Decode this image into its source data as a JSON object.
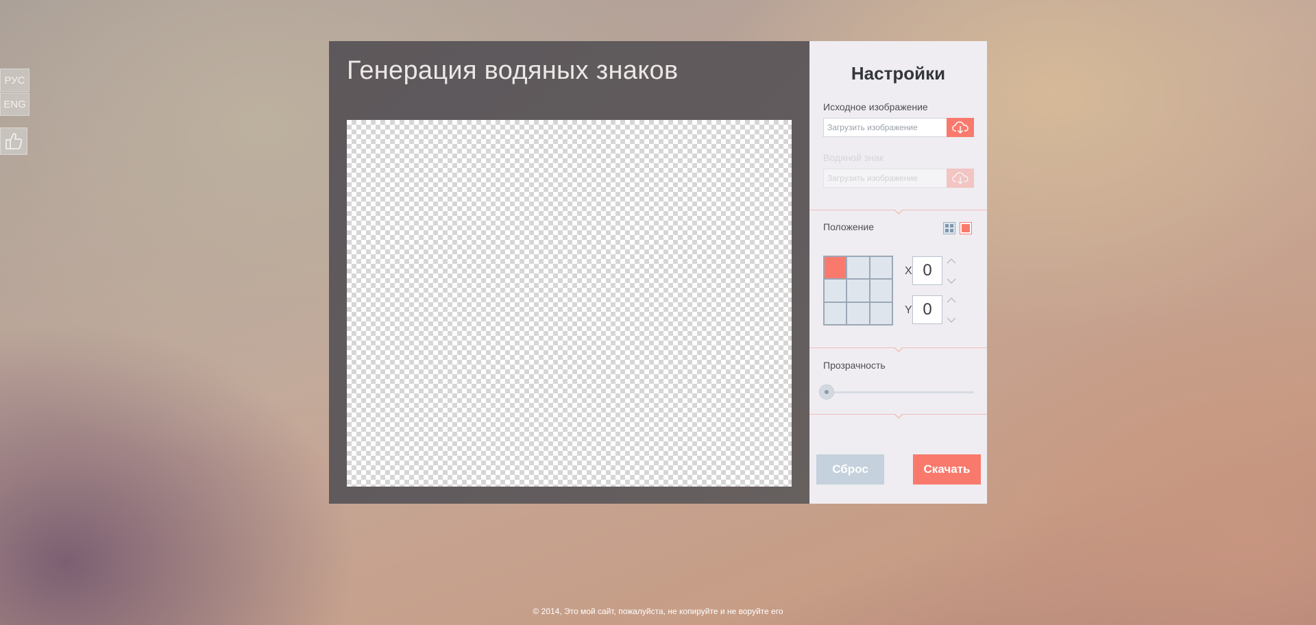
{
  "languages": [
    "РУС",
    "ENG"
  ],
  "app": {
    "title": "Генерация водяных знаков"
  },
  "settings": {
    "title": "Настройки",
    "source": {
      "label": "Исходное изображение",
      "placeholder": "Загрузить изображение"
    },
    "watermark": {
      "label": "Водяной знак",
      "placeholder": "Загрузить изображение",
      "disabled": true
    },
    "position": {
      "label": "Положение",
      "mode_icons": [
        "grid-mode-icon",
        "single-mode-icon"
      ],
      "selected_cell": "top-left",
      "x_label": "X",
      "x_value": "0",
      "y_label": "Y",
      "y_value": "0"
    },
    "opacity": {
      "label": "Прозрачность",
      "value": 0
    },
    "buttons": {
      "reset": "Сброс",
      "download": "Скачать"
    }
  },
  "colors": {
    "accent": "#f97a6d",
    "reset_button": "#c5d1dc",
    "panel_dark": "#5f595c",
    "panel_light": "#efedf1"
  },
  "footer": {
    "text": "© 2014, Это мой сайт, пожалуйста, не копируйте и не воруйте его"
  }
}
